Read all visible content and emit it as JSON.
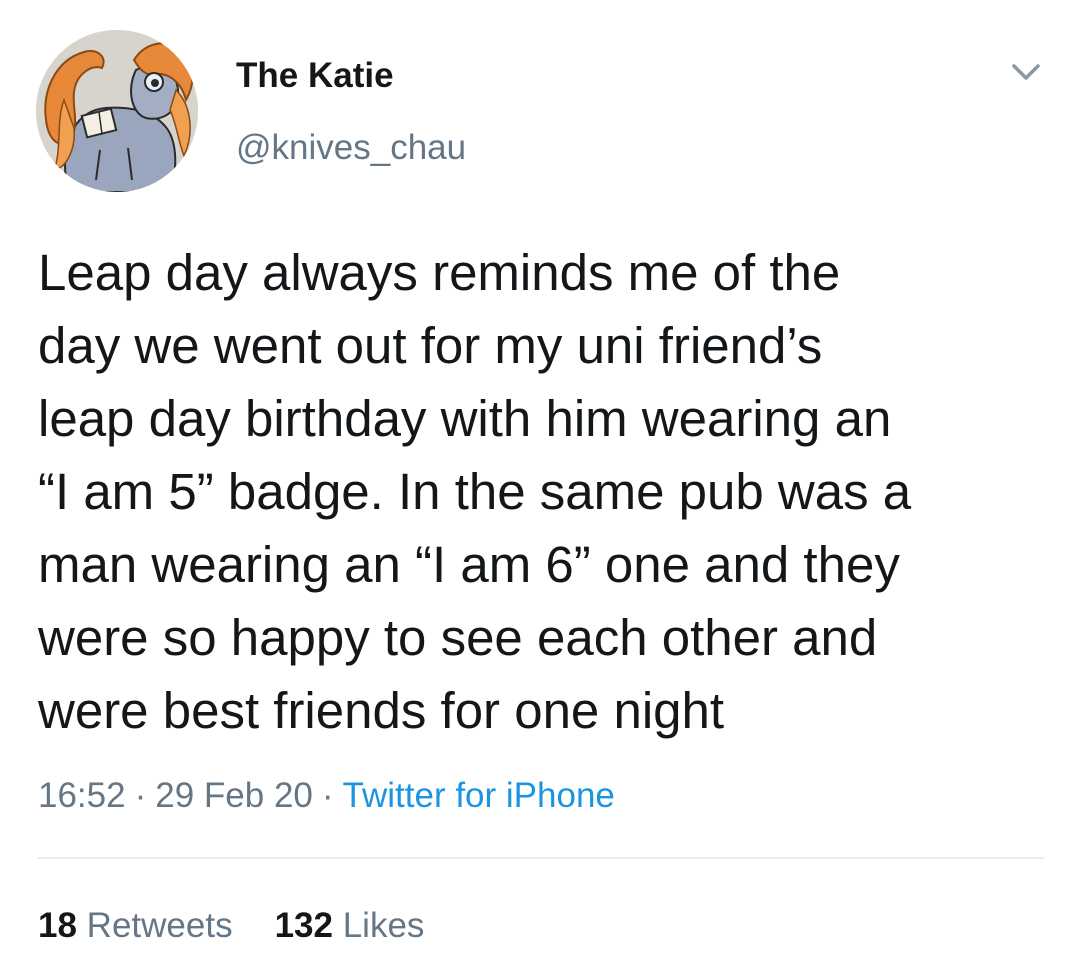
{
  "author": {
    "display_name": "The Katie",
    "handle": "@knives_chau",
    "avatar_icon": "pony-avatar-icon"
  },
  "tweet": {
    "lines": [
      "Leap day always reminds me of the",
      "day we went out for my uni friend’s",
      "leap day birthday with him wearing an",
      "“I am 5” badge. In the same pub was a",
      "man wearing an “I am 6” one and they",
      "were so happy to see each other and",
      "were best friends for one night"
    ],
    "time": "16:52",
    "date": "29 Feb 20",
    "separator": "·",
    "source": "Twitter for iPhone"
  },
  "stats": {
    "retweets_count": "18",
    "retweets_label": "Retweets",
    "likes_count": "132",
    "likes_label": "Likes"
  },
  "colors": {
    "text": "#14171a",
    "secondary": "#657786",
    "link": "#1b95e0",
    "divider": "#e6ecf0"
  },
  "icons": {
    "menu": "chevron-down-icon"
  }
}
